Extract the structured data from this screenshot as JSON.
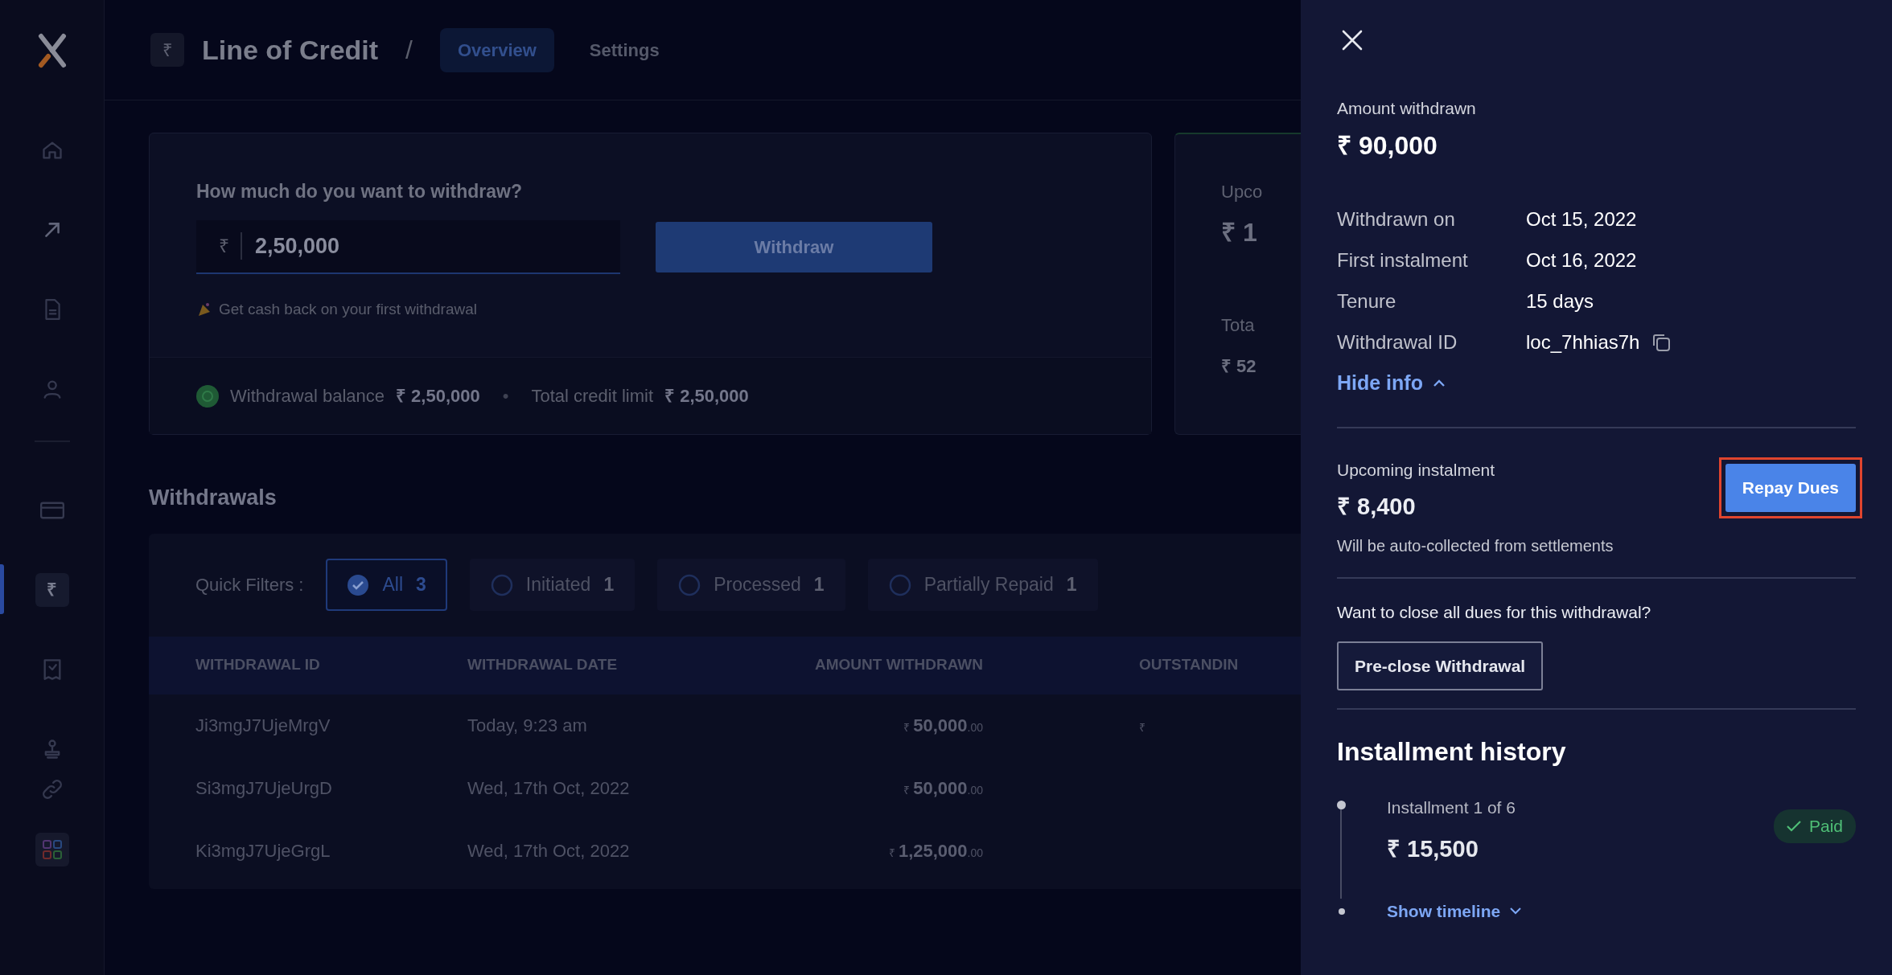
{
  "sidebar": {
    "items": [
      {
        "selected": false
      },
      {
        "selected": false
      },
      {
        "selected": false
      },
      {
        "selected": false
      },
      {
        "selected": false
      },
      {
        "selected": true,
        "symbol": "₹"
      },
      {
        "selected": false
      },
      {
        "selected": false
      },
      {
        "selected": false
      },
      {
        "selected": false
      }
    ]
  },
  "header": {
    "symbol": "₹",
    "title": "Line of Credit",
    "separator": "/",
    "tabs": [
      {
        "label": "Overview",
        "selected": true
      },
      {
        "label": "Settings",
        "selected": false
      }
    ]
  },
  "withdraw_card": {
    "question": "How much do you want to withdraw?",
    "amount_field": {
      "prefix": "₹",
      "value": "2,50,000"
    },
    "button": "Withdraw",
    "promo": "Get cash back on your first withdrawal",
    "balance_label": "Withdrawal balance",
    "balance_value": "₹ 2,50,000",
    "separator": "•",
    "limit_label": "Total credit limit",
    "limit_value": "₹ 2,50,000"
  },
  "upcoming_card": {
    "label": "Upco",
    "amount": "₹ 1",
    "total_label": "Tota",
    "total_amount": "₹ 52"
  },
  "withdrawals": {
    "title": "Withdrawals",
    "filters_label": "Quick Filters :",
    "filters": [
      {
        "label": "All",
        "count": "3",
        "selected": true
      },
      {
        "label": "Initiated",
        "count": "1",
        "selected": false
      },
      {
        "label": "Processed",
        "count": "1",
        "selected": false
      },
      {
        "label": "Partially Repaid",
        "count": "1",
        "selected": false
      }
    ],
    "table": {
      "columns": [
        "WITHDRAWAL ID",
        "WITHDRAWAL DATE",
        "AMOUNT WITHDRAWN",
        "OUTSTANDIN"
      ],
      "rows": [
        {
          "id": "Ji3mgJ7UjeMrgV",
          "date": "Today, 9:23 am",
          "amount": {
            "symbol": "₹",
            "whole": "50,000",
            "fraction": ".00"
          },
          "outstanding": "₹"
        },
        {
          "id": "Si3mgJ7UjeUrgD",
          "date": "Wed, 17th Oct, 2022",
          "amount": {
            "symbol": "₹",
            "whole": "50,000",
            "fraction": ".00"
          }
        },
        {
          "id": "Ki3mgJ7UjeGrgL",
          "date": "Wed, 17th Oct, 2022",
          "amount": {
            "symbol": "₹",
            "whole": "1,25,000",
            "fraction": ".00"
          }
        }
      ]
    }
  },
  "drawer": {
    "amount_label": "Amount withdrawn",
    "amount": "₹ 90,000",
    "details": [
      {
        "label": "Withdrawn on",
        "value": "Oct 15, 2022"
      },
      {
        "label": "First instalment",
        "value": "Oct 16, 2022"
      },
      {
        "label": "Tenure",
        "value": "15 days"
      },
      {
        "label": "Withdrawal ID",
        "value": "loc_7hhias7h",
        "copyable": true
      }
    ],
    "info_toggle": {
      "label": "Hide info",
      "expanded": true
    },
    "upcoming": {
      "label": "Upcoming instalment",
      "amount": "₹ 8,400",
      "note": "Will be auto-collected from settlements",
      "button": "Repay Dues",
      "highlighted": true
    },
    "preclose": {
      "question": "Want to close all dues for this withdrawal?",
      "button": "Pre-close Withdrawal"
    },
    "history": {
      "title": "Installment history",
      "items": [
        {
          "label": "Installment 1 of 6",
          "amount": "₹ 15,500",
          "status": "Paid",
          "kind": "paid"
        }
      ],
      "more": {
        "label": "Show timeline",
        "expanded": false
      }
    }
  }
}
